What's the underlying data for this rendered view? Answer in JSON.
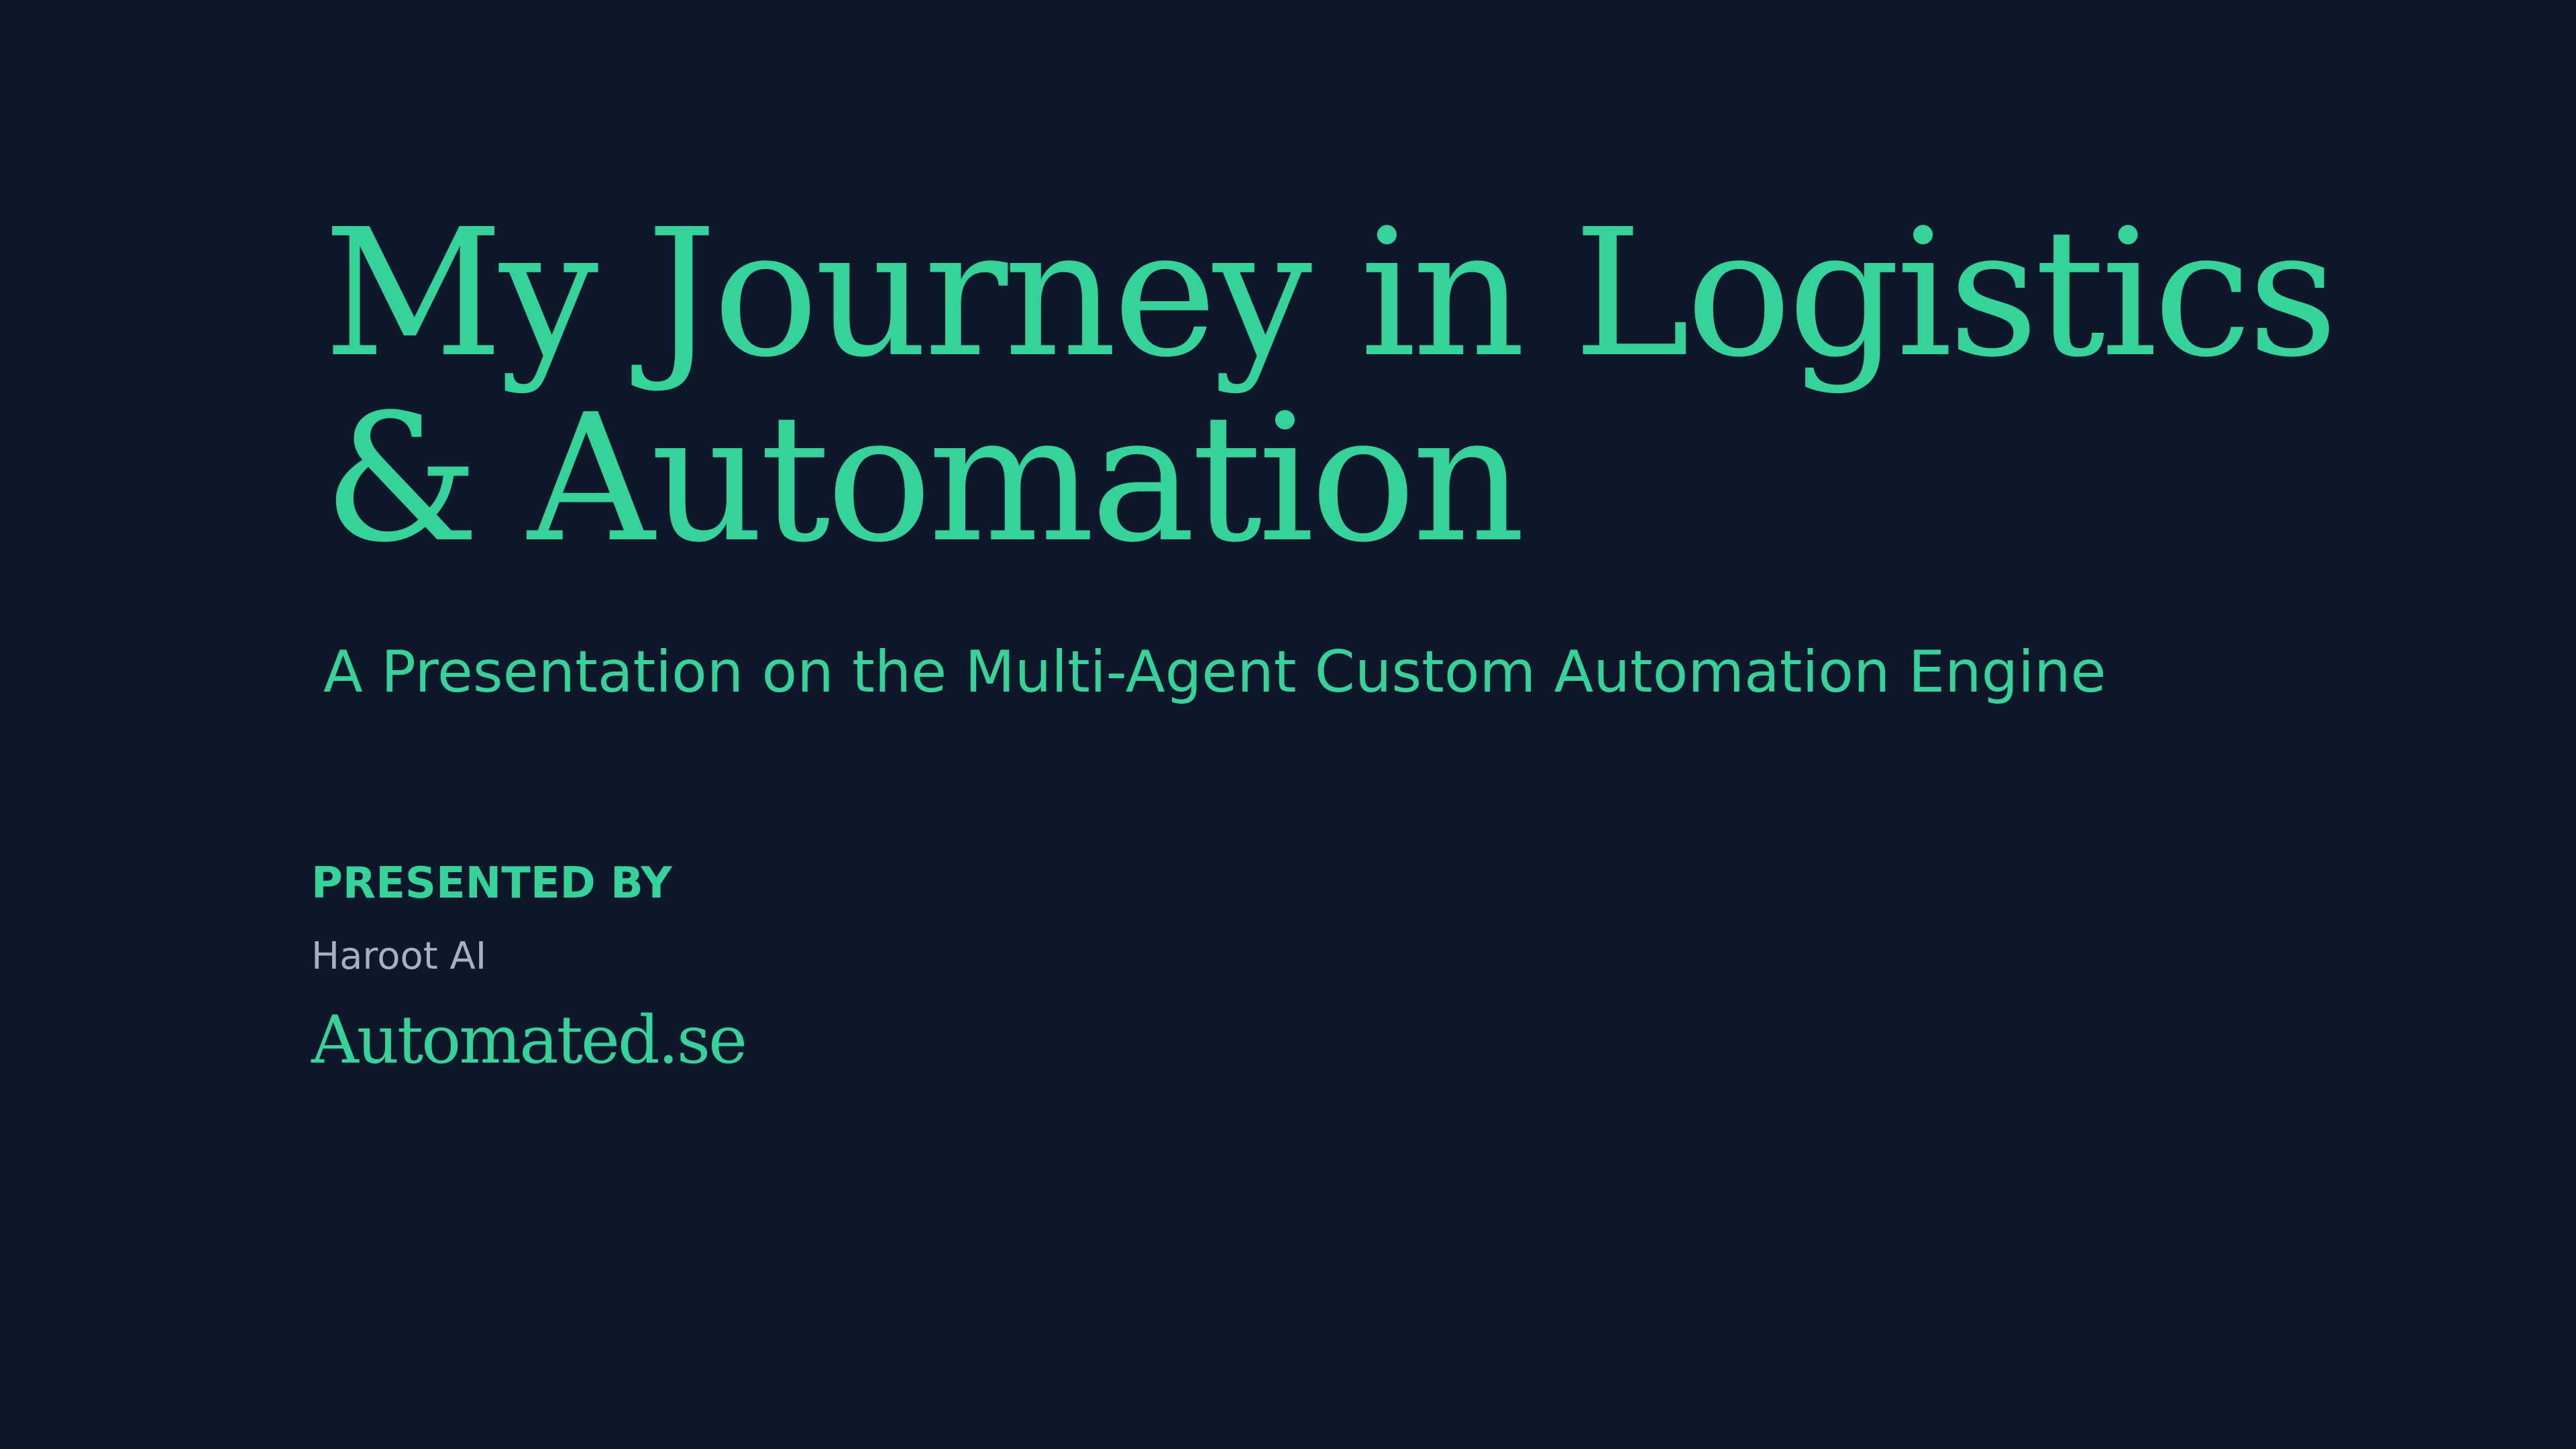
{
  "slide": {
    "title_lines": [
      "My Journey in Logistics",
      "& Automation"
    ],
    "subtitle": "A Presentation on the Multi-Agent Custom Automation Engine",
    "presenter": {
      "label": "PRESENTED BY",
      "name": "Haroot AI",
      "site": "Automated.se"
    }
  },
  "colors": {
    "background": "#0e182a",
    "accent": "#34d399",
    "muted_text": "#a7b0bf"
  }
}
